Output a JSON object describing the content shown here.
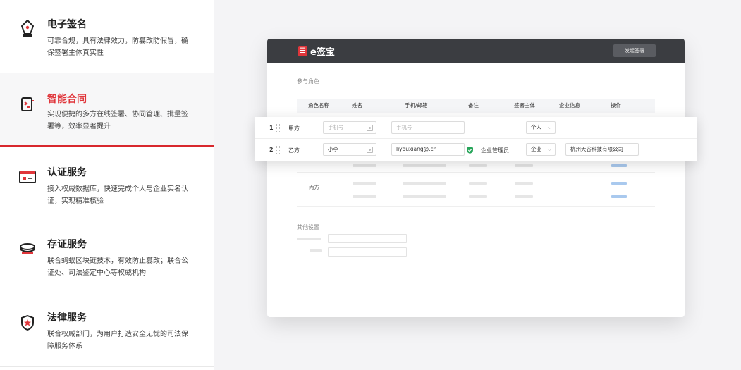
{
  "features": [
    {
      "title": "电子签名",
      "desc": "可靠合规，具有法律效力，防篡改防假冒，确保签署主体真实性",
      "icon": "pen-nib-icon",
      "active": false
    },
    {
      "title": "智能合同",
      "desc": "实现便捷的多方在线签署、协同管理、批量签署等，效率显著提升",
      "icon": "contract-icon",
      "active": true
    },
    {
      "title": "认证服务",
      "desc": "接入权威数据库，快速完成个人与企业实名认证，实现精准核验",
      "icon": "id-card-icon",
      "active": false
    },
    {
      "title": "存证服务",
      "desc": "联合蚂蚁区块链技术，有效防止篡改；联合公证处、司法鉴定中心等权威机构",
      "icon": "evidence-stamp-icon",
      "active": false
    },
    {
      "title": "法律服务",
      "desc": "联合权威部门，为用户打造安全无忧的司法保障服务体系",
      "icon": "shield-star-icon",
      "active": false
    }
  ],
  "colors": {
    "accent": "#e0363b",
    "topbar": "#3b3d41",
    "link_blue": "#a9c9ee",
    "verified_green": "#27a55a"
  },
  "mockup": {
    "logo_text": "e签宝",
    "start_button": "发起签署",
    "participants_label": "参与角色",
    "table_headers": [
      "角色名称",
      "姓名",
      "手机/邮箱",
      "备注",
      "签署主体",
      "企业信息",
      "操作"
    ],
    "rows": [
      {
        "index": "1",
        "role": "甲方",
        "name_placeholder": "手机号",
        "contact_placeholder": "手机号",
        "subject": "个人"
      },
      {
        "index": "2",
        "role": "乙方",
        "name": "小李",
        "contact": "liyouxiang@.cn",
        "note": "企业管理员",
        "subject": "企业",
        "company": "杭州天谷科技有限公司"
      }
    ],
    "third_role": "丙方",
    "other_settings_label": "其他设置"
  }
}
